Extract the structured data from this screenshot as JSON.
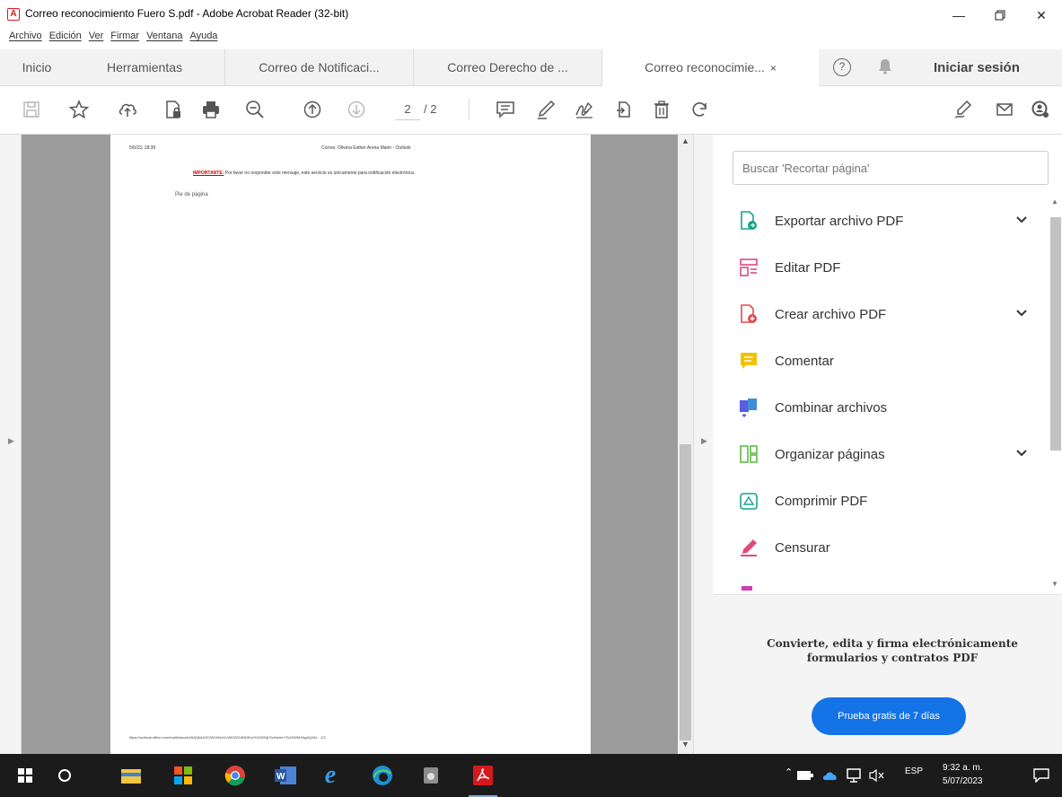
{
  "window": {
    "title": "Correo reconocimiento Fuero S.pdf - Adobe Acrobat Reader (32-bit)",
    "app_icon": "acrobat-icon",
    "controls": [
      "minimize-icon",
      "maximize-icon",
      "close-icon"
    ]
  },
  "menu": [
    "Archivo",
    "Edición",
    "Ver",
    "Firmar",
    "Ventana",
    "Ayuda"
  ],
  "tabs": {
    "home": "Inicio",
    "tools": "Herramientas",
    "docs": [
      {
        "label": "Correo de Notificaci...",
        "active": false
      },
      {
        "label": "Correo Derecho de ...",
        "active": false
      },
      {
        "label": "Correo reconocimie...",
        "active": true
      }
    ],
    "close_symbol": "×",
    "help_symbol": "?",
    "sign_in": "Iniciar sesión"
  },
  "toolbar": {
    "icons": [
      "save-icon",
      "bookmark-star-icon",
      "cloud-upload-icon",
      "file-lock-icon",
      "print-icon",
      "zoom-out-icon",
      "page-up-icon",
      "page-down-icon",
      "comment-icon",
      "highlight-pen-icon",
      "sign-icon",
      "share-icon",
      "delete-icon",
      "rotate-icon",
      "fill-sign-icon",
      "email-icon",
      "account-icon"
    ],
    "current_page": "2",
    "total_pages": "/ 2"
  },
  "document": {
    "date": "5/6/23, 18:39",
    "header": "Correo: Olivera Esther Arena Marin - Outlook",
    "important_label": "IMPORTANTE:",
    "important_text": " Por favor no responder este mensaje, este servicio es únicamente para notificación electrónica.",
    "footer_image_alt": "Pie de página",
    "url": "https://outlook.office.com/mail/inbox/id/AAQkAGI2ZWVhNzI1LWI0ZGUtNDEwYi1iODNjLTkzNzlmYTk4ZWM1NgAQAN...   2/2"
  },
  "panel": {
    "search_placeholder": "Buscar 'Recortar página'",
    "tools": [
      {
        "label": "Exportar archivo PDF",
        "icon": "export-pdf-icon",
        "color": "#17a38e",
        "chevron": "⌄"
      },
      {
        "label": "Editar PDF",
        "icon": "edit-pdf-icon",
        "color": "#e14a7c",
        "chevron": ""
      },
      {
        "label": "Crear archivo PDF",
        "icon": "create-pdf-icon",
        "color": "#e34850",
        "chevron": "⌄"
      },
      {
        "label": "Comentar",
        "icon": "comment-icon",
        "color": "#f2c200",
        "chevron": ""
      },
      {
        "label": "Combinar archivos",
        "icon": "combine-files-icon",
        "color": "#5c5ce0",
        "chevron": ""
      },
      {
        "label": "Organizar páginas",
        "icon": "organize-pages-icon",
        "color": "#5fb946",
        "chevron": "⌄"
      },
      {
        "label": "Comprimir PDF",
        "icon": "compress-pdf-icon",
        "color": "#17a38e",
        "chevron": ""
      },
      {
        "label": "Censurar",
        "icon": "redact-icon",
        "color": "#e14a7c",
        "chevron": ""
      }
    ],
    "promo_text": "Convierte, edita y firma electrónicamente formularios y contratos PDF",
    "promo_button": "Prueba gratis de 7 días",
    "accent": "#1473e6"
  },
  "taskbar": {
    "apps": [
      "windows-start-icon",
      "search-circle-icon",
      "file-explorer-icon",
      "store-icon",
      "chrome-icon",
      "word-icon",
      "edge-legacy-icon",
      "edge-icon",
      "media-icon",
      "acrobat-taskbar-icon"
    ],
    "tray_lang": "ESP",
    "time": "9:32 a. m.",
    "date": "5/07/2023"
  }
}
